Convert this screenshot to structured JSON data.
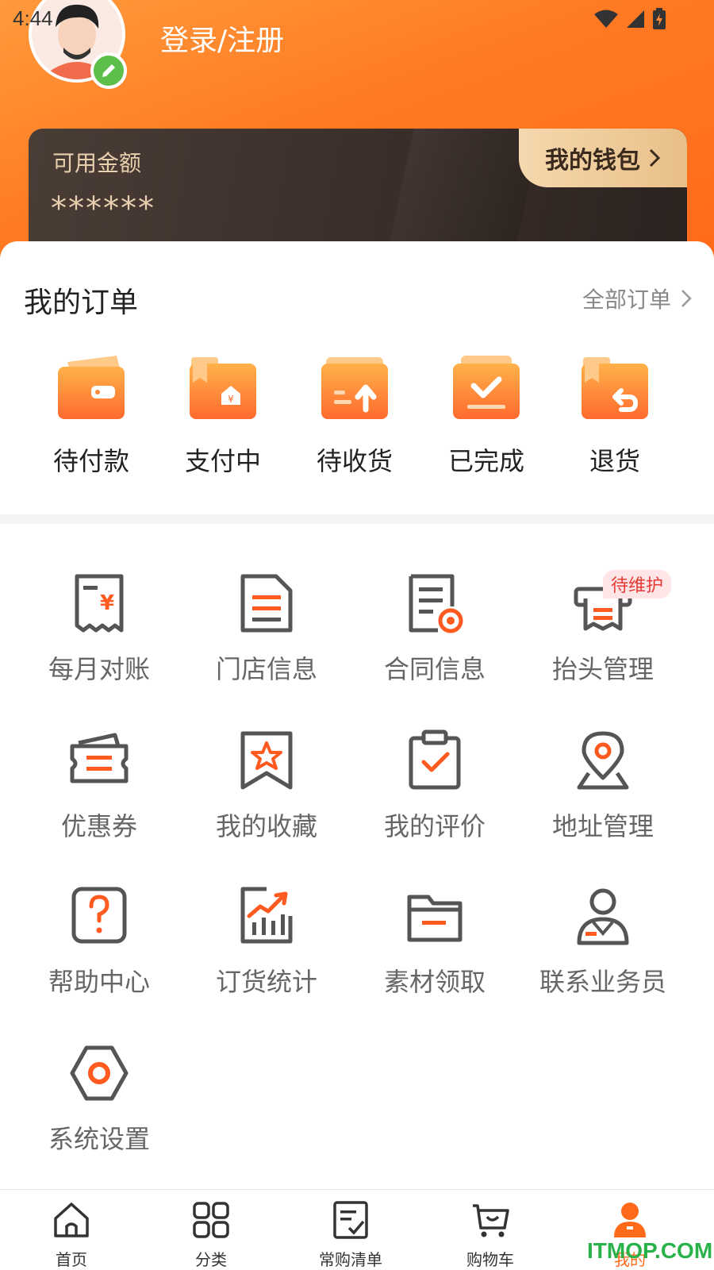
{
  "status": {
    "time": "4:44"
  },
  "header": {
    "login_label": "登录/注册"
  },
  "wallet": {
    "balance_label": "可用金额",
    "balance_masked": "******",
    "wallet_button": "我的钱包"
  },
  "orders": {
    "title": "我的订单",
    "all_label": "全部订单",
    "items": [
      {
        "label": "待付款",
        "icon": "wallet-icon"
      },
      {
        "label": "支付中",
        "icon": "paying-icon"
      },
      {
        "label": "待收货",
        "icon": "receive-icon"
      },
      {
        "label": "已完成",
        "icon": "completed-icon"
      },
      {
        "label": "退货",
        "icon": "return-icon"
      }
    ]
  },
  "services": {
    "items": [
      {
        "label": "每月对账",
        "icon": "receipt-icon"
      },
      {
        "label": "门店信息",
        "icon": "document-icon"
      },
      {
        "label": "合同信息",
        "icon": "contract-icon"
      },
      {
        "label": "抬头管理",
        "icon": "invoice-icon",
        "badge": "待维护"
      },
      {
        "label": "优惠券",
        "icon": "coupon-icon"
      },
      {
        "label": "我的收藏",
        "icon": "star-bookmark-icon"
      },
      {
        "label": "我的评价",
        "icon": "clipboard-check-icon"
      },
      {
        "label": "地址管理",
        "icon": "location-pin-icon"
      },
      {
        "label": "帮助中心",
        "icon": "help-icon"
      },
      {
        "label": "订货统计",
        "icon": "chart-icon"
      },
      {
        "label": "素材领取",
        "icon": "folder-icon"
      },
      {
        "label": "联系业务员",
        "icon": "salesperson-icon"
      },
      {
        "label": "系统设置",
        "icon": "settings-icon"
      }
    ]
  },
  "tabbar": {
    "items": [
      {
        "label": "首页",
        "icon": "home-icon"
      },
      {
        "label": "分类",
        "icon": "category-icon"
      },
      {
        "label": "常购清单",
        "icon": "list-icon"
      },
      {
        "label": "购物车",
        "icon": "cart-icon"
      },
      {
        "label": "我的",
        "icon": "profile-icon",
        "active": true
      }
    ]
  },
  "watermark": "ITMOP.COM",
  "colors": {
    "accent": "#ff6a1a",
    "icon_gray": "#555555",
    "wallet_gold": "#e8cfae"
  }
}
